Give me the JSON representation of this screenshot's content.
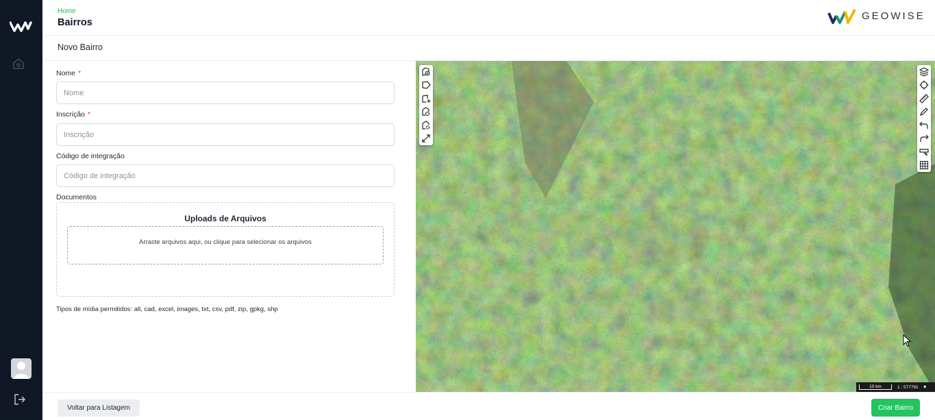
{
  "header": {
    "breadcrumb": "Home",
    "title": "Bairros",
    "brand_name": "GEOWISE"
  },
  "subheader": {
    "title": "Novo Bairro"
  },
  "sidebar": {
    "logo_icon": "w-logo-icon",
    "items": [
      {
        "icon": "home-icon"
      }
    ],
    "avatar_icon": "user-avatar-icon",
    "logout_icon": "logout-icon"
  },
  "form": {
    "nome": {
      "label": "Nome",
      "required_mark": "*",
      "placeholder": "Nome",
      "value": ""
    },
    "inscricao": {
      "label": "Inscrição",
      "required_mark": "*",
      "placeholder": "Inscrição",
      "value": ""
    },
    "codigo": {
      "label": "Código de integração",
      "placeholder": "Código de integração",
      "value": ""
    },
    "documentos": {
      "label": "Documentos",
      "upload_title": "Uploads de Arquivos",
      "dropzone_text": "Arraste arquivos aqui, ou clique para selecionar os arquivos"
    },
    "media_types": "Tipos de mídia permitidos: all, cad, excel, images, txt, csv, pdf, zip, gpkg, shp"
  },
  "map": {
    "left_tools": [
      "add-feature-icon",
      "draw-polygon-icon",
      "add-vertex-icon",
      "search-polygon-icon",
      "settings-polygon-icon",
      "expand-icon"
    ],
    "right_tools": [
      "layers-icon",
      "target-icon",
      "ruler-icon",
      "pencil-icon",
      "undo-icon",
      "redo-icon",
      "eraser-icon",
      "grid-icon"
    ],
    "scale_label": "10 km",
    "scale_ratio": "1 : 577791"
  },
  "footer": {
    "back_label": "Voltar para Listagem",
    "create_label": "Criar Bairro",
    "create_color": "#22c55e"
  }
}
